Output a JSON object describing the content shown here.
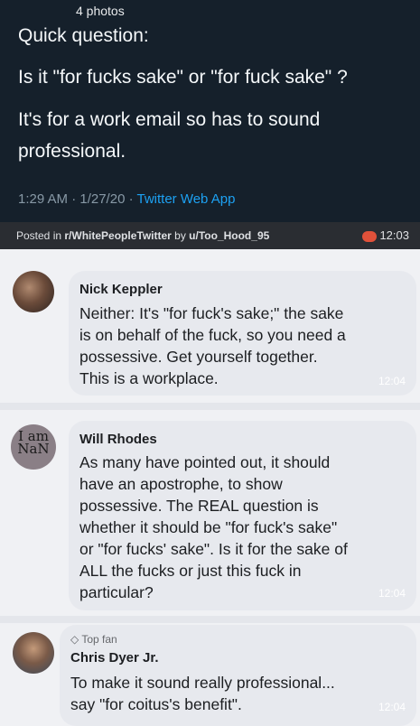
{
  "tweet": {
    "photos_label": "4 photos",
    "lines": [
      "Quick question:",
      "Is it \"for fucks sake\" or \"for fuck sake\" ?",
      "It's for a work email so has to sound",
      "professional."
    ],
    "timestamp": "1:29 AM · 1/27/20 · ",
    "source": "Twitter Web App"
  },
  "post_bar": {
    "prefix": "Posted in ",
    "subreddit": "r/WhitePeopleTwitter",
    "middle": " by ",
    "user": "u/Too_Hood_95",
    "time": "12:03"
  },
  "comments": [
    {
      "name": "Nick Keppler",
      "lines": [
        "Neither: It's \"for fuck's sake;\" the sake",
        "is on behalf of the fuck, so you need a",
        "possessive. Get yourself together.",
        "This is a workplace."
      ],
      "time": "12:04"
    },
    {
      "name": "Will Rhodes",
      "avatar_text": "I am NaN",
      "lines": [
        "As many have pointed out, it should",
        "have an apostrophe, to show",
        "possessive. The REAL question is",
        "whether it should be \"for fuck's sake\"",
        "or \"for fucks' sake\". Is it for the sake of",
        "ALL the fucks or just this fuck in",
        "particular?"
      ],
      "time": "12:04"
    },
    {
      "badge": "Top fan",
      "name": "Chris Dyer Jr.",
      "lines": [
        "To make it sound really professional...",
        "say \"for coitus's benefit\"."
      ],
      "time": "12:04"
    }
  ],
  "colors": {
    "tweet_bg": "#15202b",
    "link_blue": "#1da1f2",
    "bubble_bg": "#e7e9ee"
  }
}
